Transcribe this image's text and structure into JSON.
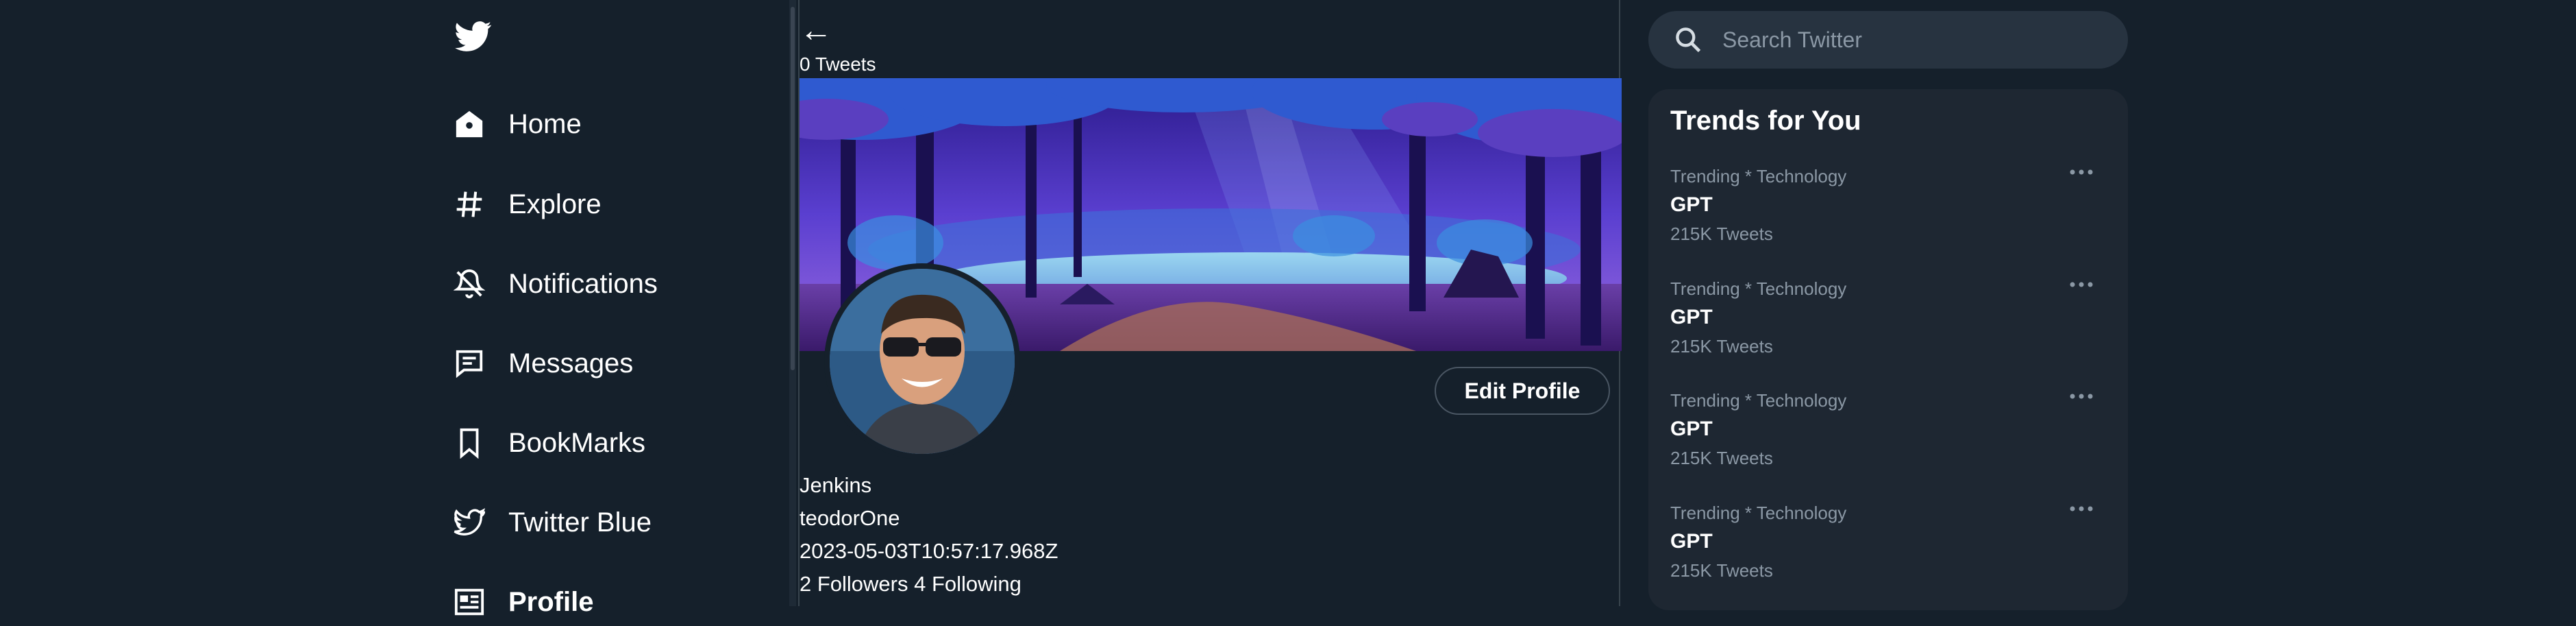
{
  "sidebar": {
    "logo": "twitter-bird-icon",
    "items": [
      {
        "label": "Home",
        "icon": "home-icon"
      },
      {
        "label": "Explore",
        "icon": "hashtag-icon"
      },
      {
        "label": "Notifications",
        "icon": "bell-icon"
      },
      {
        "label": "Messages",
        "icon": "message-icon"
      },
      {
        "label": "BookMarks",
        "icon": "bookmark-icon"
      },
      {
        "label": "Twitter Blue",
        "icon": "twitter-blue-icon"
      },
      {
        "label": "Profile",
        "icon": "profile-card-icon"
      }
    ]
  },
  "profile": {
    "back_symbol": "←",
    "tweet_count": "0 Tweets",
    "edit_button": "Edit Profile",
    "name": "Jenkins",
    "handle": "teodorOne",
    "joined": "2023-05-03T10:57:17.968Z",
    "follow_stats": "2 Followers 4 Following"
  },
  "search": {
    "placeholder": "Search Twitter",
    "icon": "search-icon"
  },
  "trends": {
    "title": "Trends for You",
    "items": [
      {
        "category": "Trending * Technology",
        "name": "GPT",
        "count": "215K Tweets"
      },
      {
        "category": "Trending * Technology",
        "name": "GPT",
        "count": "215K Tweets"
      },
      {
        "category": "Trending * Technology",
        "name": "GPT",
        "count": "215K Tweets"
      },
      {
        "category": "Trending * Technology",
        "name": "GPT",
        "count": "215K Tweets"
      }
    ]
  },
  "colors": {
    "background": "#15202b",
    "panel": "#1e2732",
    "search_bg": "#273340",
    "muted_text": "#8b98a5",
    "border": "#38444d"
  }
}
